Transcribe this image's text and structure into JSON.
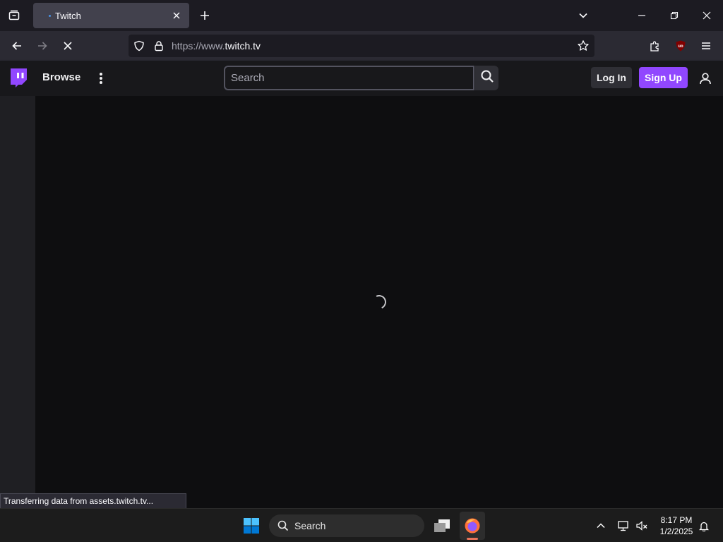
{
  "browser": {
    "tab": {
      "title": "Twitch"
    },
    "url": {
      "prefix": "https://www.",
      "domain": "twitch.tv"
    },
    "status_text": "Transferring data from assets.twitch.tv..."
  },
  "twitch": {
    "nav": {
      "browse_label": "Browse"
    },
    "search": {
      "placeholder": "Search"
    },
    "buttons": {
      "login_label": "Log In",
      "signup_label": "Sign Up"
    },
    "colors": {
      "brand": "#9147ff",
      "background": "#0e0e10",
      "header": "#18181b"
    }
  },
  "taskbar": {
    "search_label": "Search",
    "time": "8:17 PM",
    "date": "1/2/2025"
  },
  "icons": [
    "tab-overview-icon",
    "favicon-dot",
    "close-icon",
    "new-tab-icon",
    "tab-list-chevron-icon",
    "minimize-icon",
    "restore-icon",
    "window-close-icon",
    "back-arrow-icon",
    "forward-arrow-icon",
    "stop-loading-icon",
    "shield-icon",
    "lock-icon",
    "bookmark-star-icon",
    "extensions-icon",
    "ublock-icon",
    "hamburger-menu-icon",
    "twitch-logo",
    "more-vertical-icon",
    "search-icon",
    "user-icon",
    "loading-spinner",
    "windows-start-icon",
    "task-view-icon",
    "firefox-icon",
    "chevron-up-icon",
    "network-icon",
    "volume-muted-icon",
    "notification-bell-icon"
  ]
}
